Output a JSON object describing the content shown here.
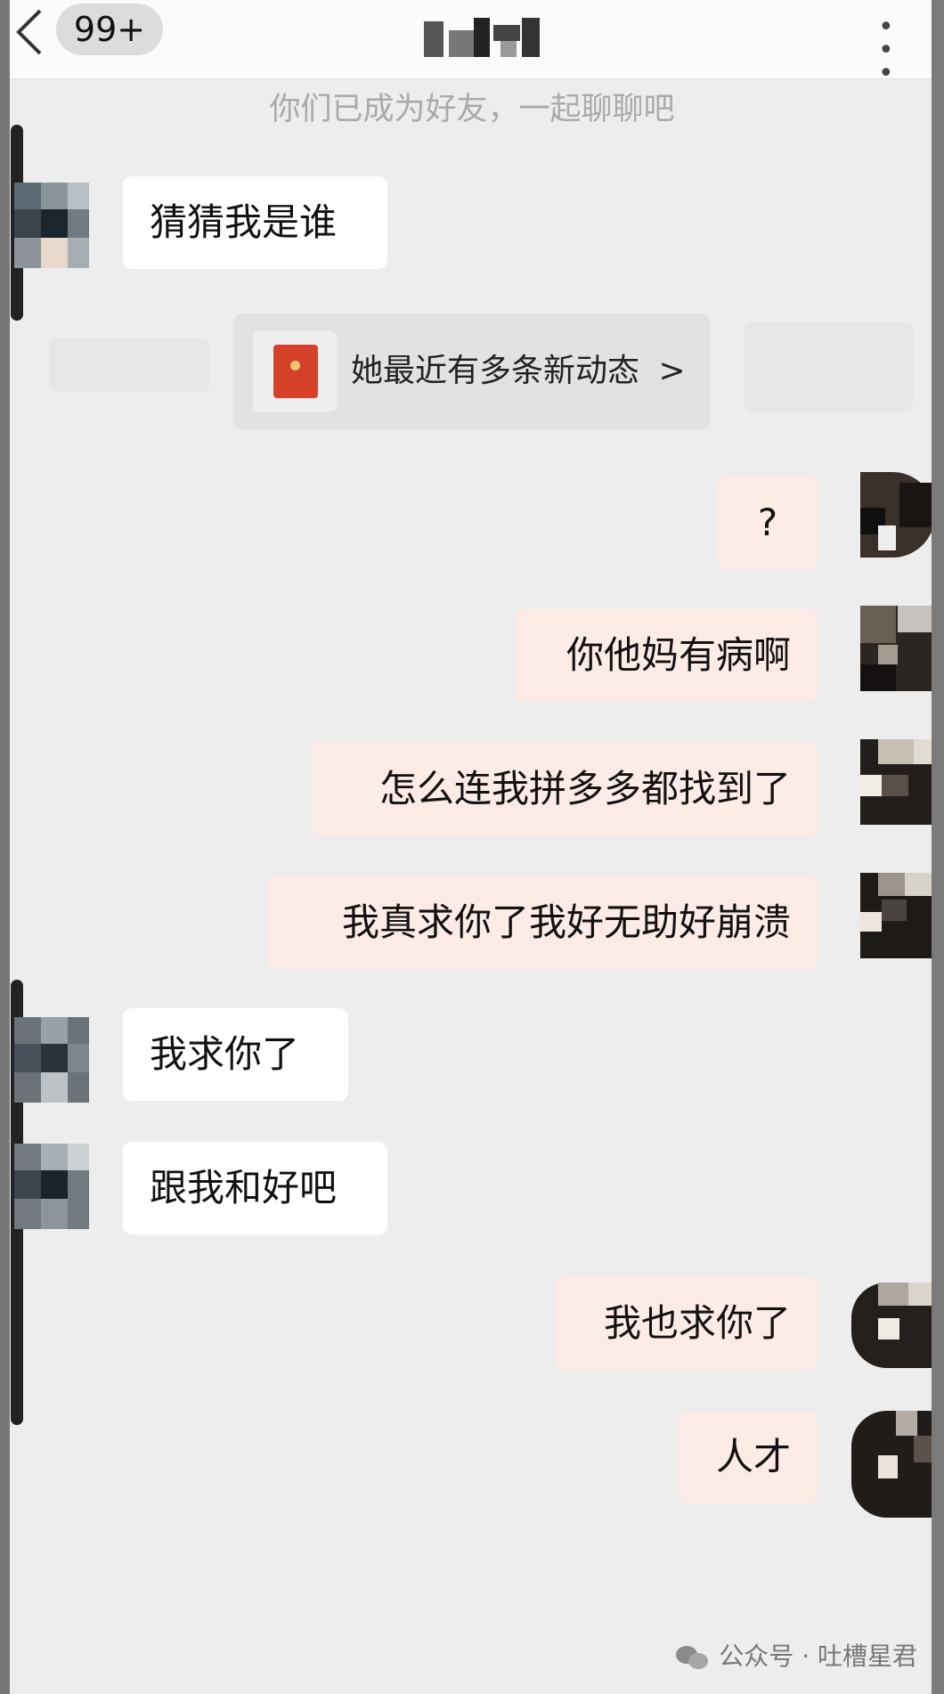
{
  "header": {
    "back_label": "<",
    "badge": "99+",
    "more_label": "• • •"
  },
  "system_tip": "你们已成为好友，一起聊聊吧",
  "messages": {
    "m1": "猜猜我是谁",
    "m2": "?",
    "m3": "你他妈有病啊",
    "m4": "怎么连我拼多多都找到了",
    "m5": "我真求你了我好无助好崩溃",
    "m6": "我求你了",
    "m7": "跟我和好吧",
    "m8": "我也求你了",
    "m9": "人才"
  },
  "dynamic_card": {
    "text": "她最近有多条新动态",
    "chevron": ">"
  },
  "footer": {
    "text": "公众号 · 吐槽星君"
  },
  "colors": {
    "background": "#ededed",
    "incoming_bubble": "#ffffff",
    "outgoing_bubble": "#fdebe6",
    "red_packet": "#d5402b"
  }
}
